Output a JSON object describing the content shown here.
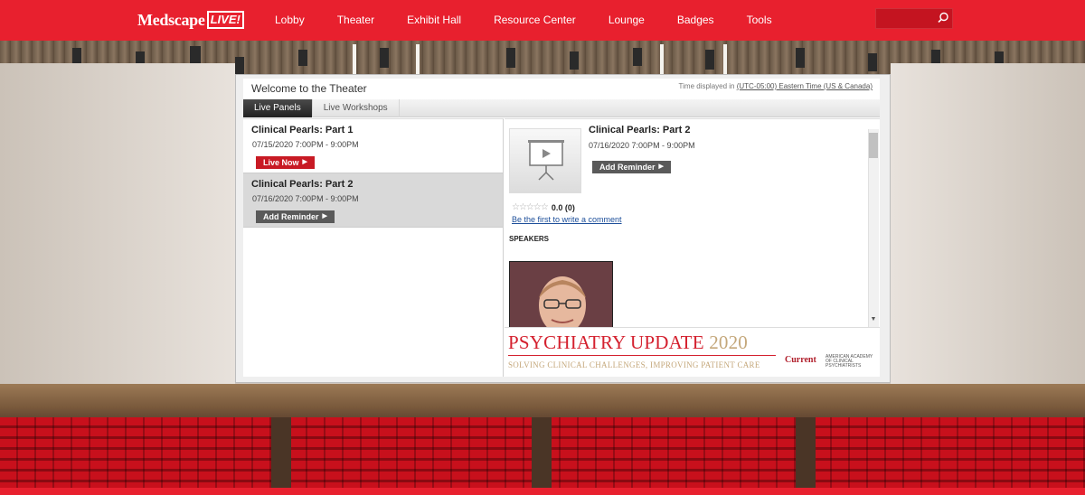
{
  "brand": {
    "name": "Medscape",
    "badge": "LIVE!"
  },
  "nav": {
    "items": [
      {
        "label": "Lobby"
      },
      {
        "label": "Theater"
      },
      {
        "label": "Exhibit Hall"
      },
      {
        "label": "Resource Center"
      },
      {
        "label": "Lounge"
      },
      {
        "label": "Badges"
      },
      {
        "label": "Tools"
      }
    ],
    "search_placeholder": "",
    "search_icon": "search-icon"
  },
  "colors": {
    "brand_red": "#e8202e",
    "live_button": "#c81a24",
    "remind_button": "#5a5a5a",
    "link": "#1d4f9a"
  },
  "panel": {
    "title": "Welcome to the Theater",
    "tz_prefix": "Time displayed in ",
    "tz_link": "(UTC-05:00) Eastern Time (US & Canada)",
    "tabs": [
      {
        "label": "Live Panels",
        "active": true
      },
      {
        "label": "Live Workshops",
        "active": false
      }
    ]
  },
  "sessions": [
    {
      "title": "Clinical Pearls: Part 1",
      "datetime": "07/15/2020 7:00PM - 9:00PM",
      "button": "Live Now"
    },
    {
      "title": "Clinical Pearls: Part 2",
      "datetime": "07/16/2020 7:00PM - 9:00PM",
      "button": "Add Reminder"
    }
  ],
  "detail": {
    "title": "Clinical Pearls: Part 2",
    "datetime": "07/16/2020 7:00PM - 9:00PM",
    "button": "Add Reminder",
    "rating_stars": 0,
    "rating": "0.0 (0)",
    "comment_link": "Be the first to write a comment",
    "speakers_heading": "SPEAKERS"
  },
  "banner": {
    "title": "PSYCHIATRY UPDATE",
    "year": "2020",
    "subtitle": "SOLVING CLINICAL CHALLENGES, IMPROVING PATIENT CARE",
    "logo1": "Current",
    "logo2": "AMERICAN ACADEMY OF CLINICAL PSYCHIATRISTS"
  }
}
